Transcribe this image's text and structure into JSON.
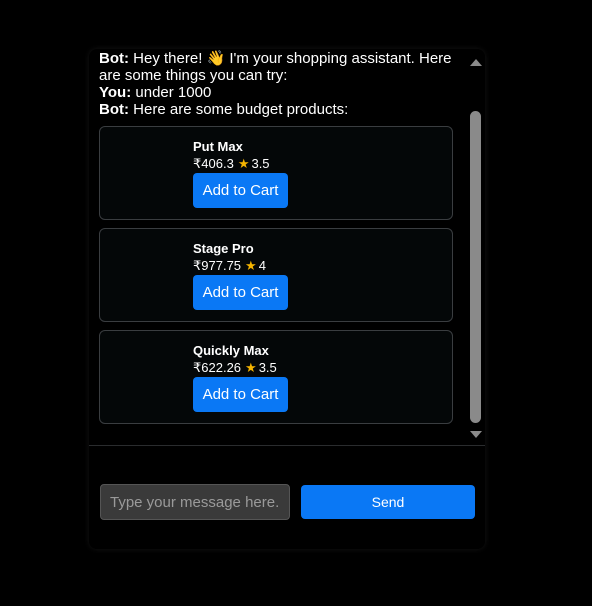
{
  "messages": [
    {
      "sender": "Bot:",
      "text": "Hey there! 👋 I'm your shopping assistant. Here are some things you can try:"
    },
    {
      "sender": "You:",
      "text": "under 1000"
    },
    {
      "sender": "Bot:",
      "text": "Here are some budget products:"
    }
  ],
  "products": [
    {
      "name": "Put Max",
      "price": "₹406.3",
      "rating": "3.5",
      "button": "Add to Cart"
    },
    {
      "name": "Stage Pro",
      "price": "₹977.75",
      "rating": "4",
      "button": "Add to Cart"
    },
    {
      "name": "Quickly Max",
      "price": "₹622.26",
      "rating": "3.5",
      "button": "Add to Cart"
    }
  ],
  "star_icon": "star-icon",
  "colors": {
    "accent": "#0a78f5",
    "star": "#f5b400"
  },
  "input": {
    "placeholder": "Type your message here...",
    "value": ""
  },
  "send_label": "Send"
}
